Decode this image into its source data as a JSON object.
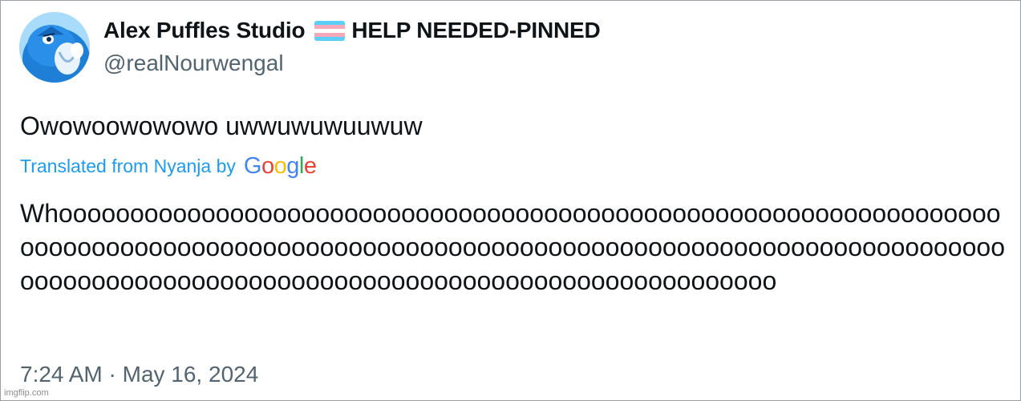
{
  "tweet": {
    "display_name": "Alex Puffles Studio",
    "name_suffix": "HELP NEEDED-PINNED",
    "handle": "@realNourwengal",
    "text": "Owowoowowowo uwwuwuwuuwuw",
    "translated_label": "Translated from Nyanja by",
    "translation_provider": "Google",
    "translation": "Whoooooooooooooooooooooooooooooooooooooooooooooooooooooooooooooooooooooooooooooooooooooooooooooooooooooooooooooooooooooooooooooooooooooooooooooooooooooooooooooooooooooooooooooooooooooooooooo",
    "timestamp": "7:24 AM · May 16, 2024"
  },
  "flag_colors": [
    "#5bcefa",
    "#f5a9b8",
    "#ffffff",
    "#f5a9b8",
    "#5bcefa"
  ],
  "avatar_icon": "blue-creature-avatar",
  "google_logo_colors": [
    "#4285f4",
    "#ea4335",
    "#fbbc05",
    "#4285f4",
    "#34a853",
    "#ea4335"
  ],
  "watermark": "imgflip.com"
}
